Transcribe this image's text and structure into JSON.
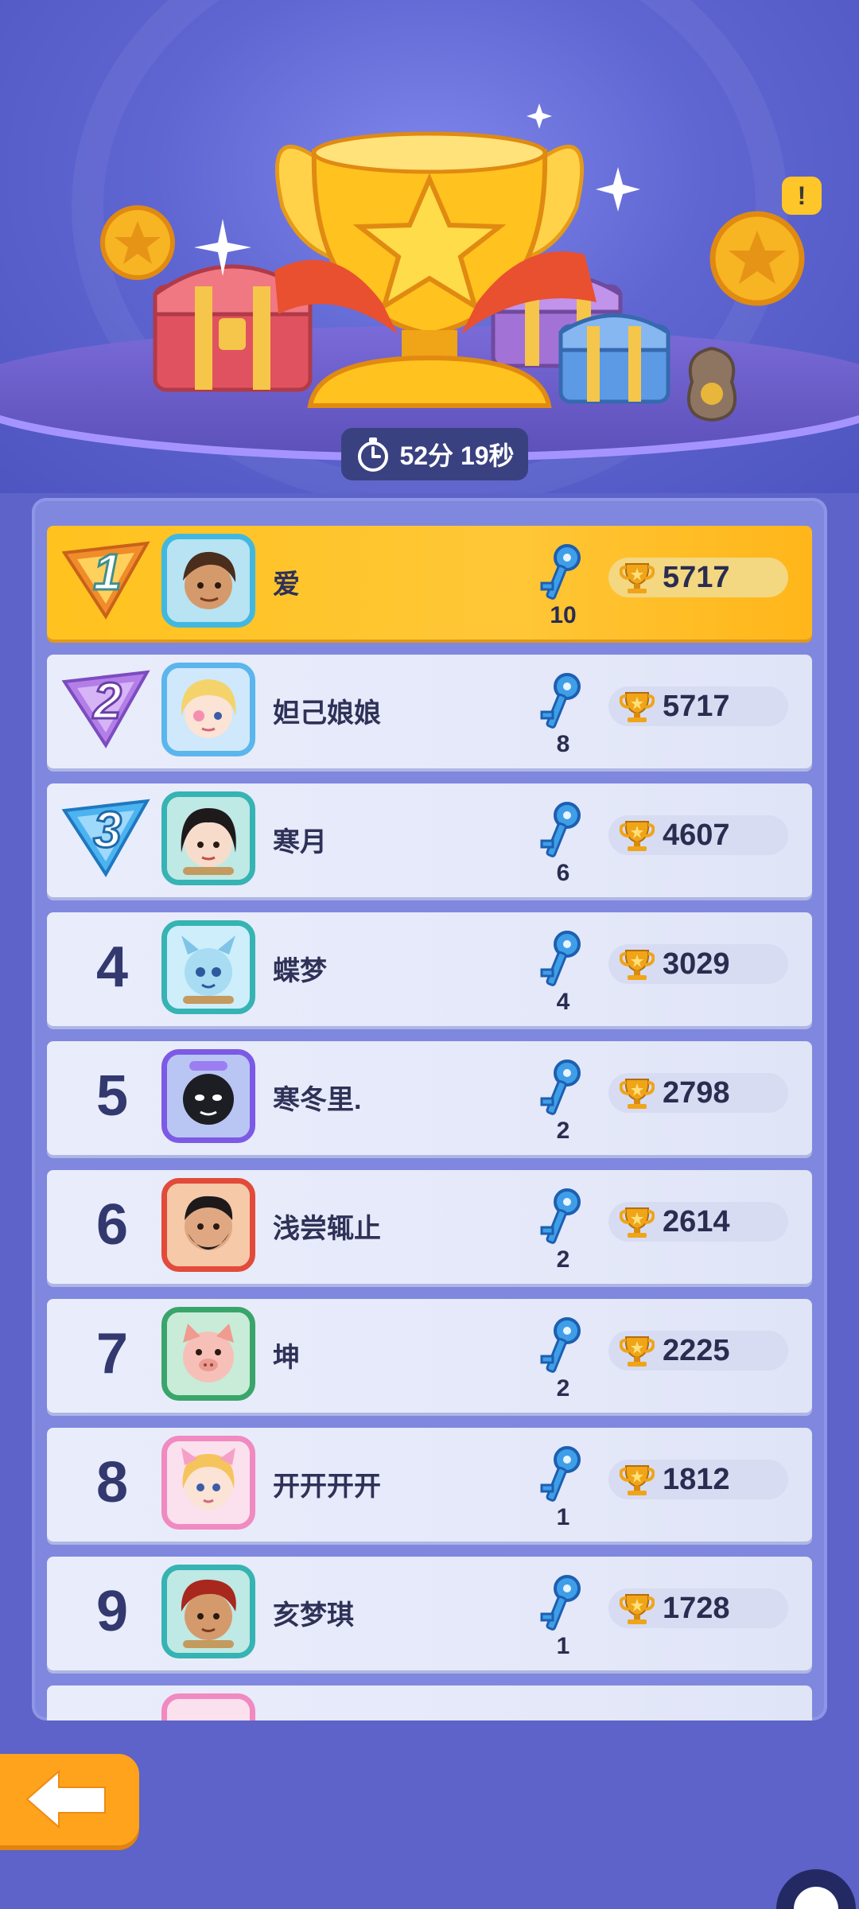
{
  "timer": {
    "text": "52分 19秒"
  },
  "alert": {
    "symbol": "!"
  },
  "colors": {
    "background": "#5d63c8",
    "gold_row": "#ffc21e",
    "row": "#e9edfb",
    "accent": "#ffa31c"
  },
  "leaderboard": [
    {
      "rank": "1",
      "name": "爱",
      "keys": "10",
      "score": "5717",
      "avatar_icon": "avatar-brown-hair-icon",
      "frame": "#42b8e0"
    },
    {
      "rank": "2",
      "name": "妲己娘娘",
      "keys": "8",
      "score": "5717",
      "avatar_icon": "avatar-blonde-icon",
      "frame": "#5ab6ec"
    },
    {
      "rank": "3",
      "name": "寒月",
      "keys": "6",
      "score": "4607",
      "avatar_icon": "avatar-black-hair-icon",
      "frame": "#36b3b3"
    },
    {
      "rank": "4",
      "name": "蝶梦",
      "keys": "4",
      "score": "3029",
      "avatar_icon": "avatar-blue-creature-icon",
      "frame": "#36b3b3"
    },
    {
      "rank": "5",
      "name": "寒冬里.",
      "keys": "2",
      "score": "2798",
      "avatar_icon": "avatar-masked-icon",
      "frame": "#7c5ae6"
    },
    {
      "rank": "6",
      "name": "浅尝辄止",
      "keys": "2",
      "score": "2614",
      "avatar_icon": "avatar-bearded-icon",
      "frame": "#e24a3a"
    },
    {
      "rank": "7",
      "name": "坤",
      "keys": "2",
      "score": "2225",
      "avatar_icon": "avatar-pig-icon",
      "frame": "#3aa56a"
    },
    {
      "rank": "8",
      "name": "开开开开",
      "keys": "1",
      "score": "1812",
      "avatar_icon": "avatar-cat-girl-icon",
      "frame": "#f08ac0"
    },
    {
      "rank": "9",
      "name": "亥梦琪",
      "keys": "1",
      "score": "1728",
      "avatar_icon": "avatar-red-hair-icon",
      "frame": "#36b3b3"
    }
  ]
}
